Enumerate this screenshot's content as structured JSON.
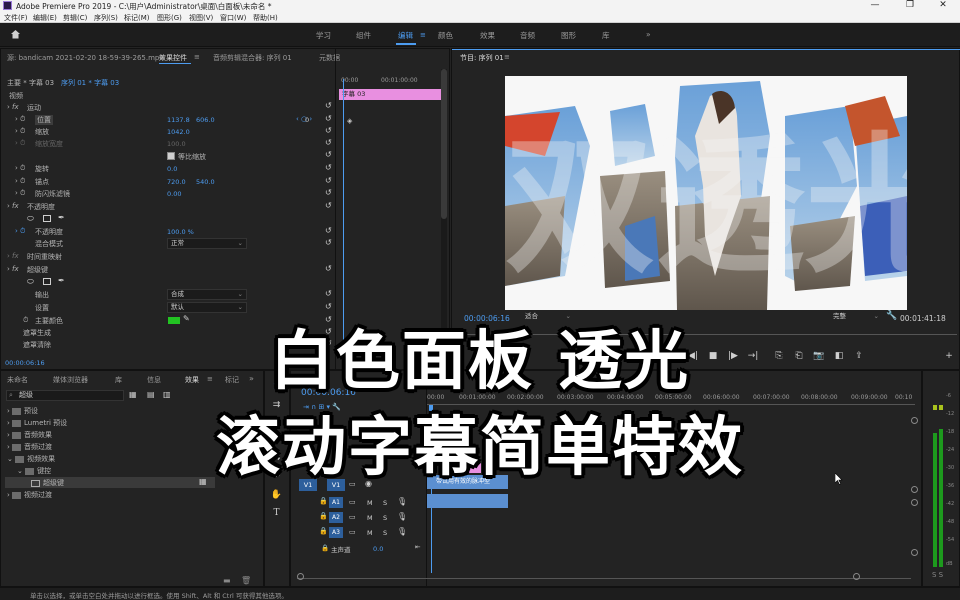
{
  "app": {
    "title": "Adobe Premiere Pro 2019 - C:\\用户\\Administrator\\桌面\\白面板\\未命名 *",
    "window_controls": [
      "—",
      "❐",
      "✕"
    ]
  },
  "menu": [
    "文件(F)",
    "编辑(E)",
    "剪辑(C)",
    "序列(S)",
    "标记(M)",
    "图形(G)",
    "视图(V)",
    "窗口(W)",
    "帮助(H)"
  ],
  "workspaces": {
    "items": [
      "学习",
      "组件",
      "编辑",
      "颜色",
      "效果",
      "音频",
      "图形",
      "库"
    ],
    "active": "编辑",
    "more": "»"
  },
  "effect_controls": {
    "source_tab": "源: bandicam 2021-02-20 18-59-39-265.mp4",
    "tabs": [
      "效果控件",
      "音频剪辑混合器: 序列 01",
      "元数据"
    ],
    "master": "主要 * 字幕 03",
    "sequence": "序列 01 * 字幕 03",
    "section_video": "视频",
    "clip_bar_label": "字幕 03",
    "mini_time_start": "00:00",
    "mini_time_end": "00:01:00:00",
    "motion": {
      "label": "运动",
      "position_label": "位置",
      "position_x": "1137.8",
      "position_y": "606.0",
      "scale_label": "缩放",
      "scale_val": "1042.0",
      "scale_width_label": "缩放宽度",
      "scale_width_val": "100.0",
      "uniform_label": "等比缩放",
      "rotation_label": "旋转",
      "rotation_val": "0.0",
      "anchor_label": "锚点",
      "anchor_x": "720.0",
      "anchor_y": "540.0",
      "flicker_label": "防闪烁滤镜",
      "flicker_val": "0.00"
    },
    "opacity": {
      "label": "不透明度",
      "opacity_label": "不透明度",
      "opacity_val": "100.0 %",
      "blend_label": "混合模式",
      "blend_val": "正常"
    },
    "time_remap": "时间重映射",
    "key": {
      "label": "超级键",
      "output_label": "输出",
      "output_val": "合成",
      "setting_label": "设置",
      "setting_val": "默认",
      "key_color_label": "主要颜色",
      "key_color": "#22c322",
      "matte_gen": "遮罩生成",
      "matte_clean": "遮罩清除"
    },
    "timecode": "00:00:06:16",
    "keyframe_val": "0"
  },
  "program": {
    "tab": "节目: 序列 01",
    "timecode": "00:00:06:16",
    "fit": "适合",
    "quality": "完整",
    "duration": "00:01:41:18",
    "preview_text": "双透光"
  },
  "project": {
    "tabs": [
      "未命名",
      "媒体浏览器",
      "库",
      "信息",
      "效果",
      "标记"
    ],
    "search_value": "超级",
    "tree": [
      {
        "label": "预设",
        "level": 0
      },
      {
        "label": "Lumetri 预设",
        "level": 0
      },
      {
        "label": "音频效果",
        "level": 0
      },
      {
        "label": "音频过渡",
        "level": 0
      },
      {
        "label": "视频效果",
        "level": 0
      },
      {
        "label": "键控",
        "level": 1
      },
      {
        "label": "超级键",
        "level": 2
      },
      {
        "label": "视频过渡",
        "level": 0
      }
    ]
  },
  "timeline": {
    "tab": "序列 01",
    "timecode": "00:00:06:16",
    "ruler": [
      "00:00",
      "00:01:00:00",
      "00:02:00:00",
      "00:03:00:00",
      "00:04:00:00",
      "00:05:00:00",
      "00:06:00:00",
      "00:07:00:00",
      "00:08:00:00",
      "00:09:00:00",
      "00:10"
    ],
    "tracks": [
      "V1",
      "A1",
      "A2",
      "A3"
    ],
    "source_patch": "V1",
    "master_label": "主声道",
    "master_val": "0.0",
    "clip_label": "带试用有效的脉冲型",
    "track_btns": [
      "M",
      "S"
    ]
  },
  "meter": {
    "labels": [
      "-6",
      "-12",
      "-18",
      "-24",
      "-30",
      "-36",
      "-42",
      "-48",
      "-54",
      "dB"
    ]
  },
  "status_bar": "单击以选择，或单击空白处并拖动以进行框选。使用 Shift、Alt 和 Ctrl 可获得其他选项。",
  "overlay": {
    "line1": "白色面板 透光",
    "line2": "滚动字幕简单特效"
  },
  "colors": {
    "accent": "#4d9cf0",
    "clip_pink": "#e88fe0",
    "clip_blue": "#5b8fd0",
    "key_green": "#22c322"
  }
}
